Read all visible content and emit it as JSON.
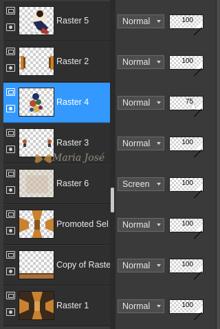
{
  "layers": [
    {
      "name": "Raster 5",
      "blend": "Normal",
      "opacity": "100",
      "selected": false,
      "thumb": "figure"
    },
    {
      "name": "Raster 2",
      "blend": "Normal",
      "opacity": "100",
      "selected": false,
      "thumb": "bars"
    },
    {
      "name": "Raster 4",
      "blend": "Normal",
      "opacity": "75",
      "selected": true,
      "thumb": "flowers"
    },
    {
      "name": "Raster 3",
      "blend": "Normal",
      "opacity": "100",
      "selected": false,
      "thumb": "small"
    },
    {
      "name": "Raster 6",
      "blend": "Screen",
      "opacity": "100",
      "selected": false,
      "thumb": "faint"
    },
    {
      "name": "Promoted Sel",
      "blend": "Normal",
      "opacity": "100",
      "selected": false,
      "thumb": "frame"
    },
    {
      "name": "Copy of Raste",
      "blend": "Normal",
      "opacity": "100",
      "selected": false,
      "thumb": "bottom"
    },
    {
      "name": "Raster 1",
      "blend": "Normal",
      "opacity": "100",
      "selected": false,
      "thumb": "dark"
    }
  ],
  "watermark": "Maria José",
  "colors": {
    "selected": "#3399ff",
    "panel": "#3a3a3a",
    "row": "#2f2f2f"
  },
  "icons": {
    "visibility": "eye-icon",
    "group": "layer-group-icon",
    "blend_dropdown": "chevron-down-icon"
  }
}
